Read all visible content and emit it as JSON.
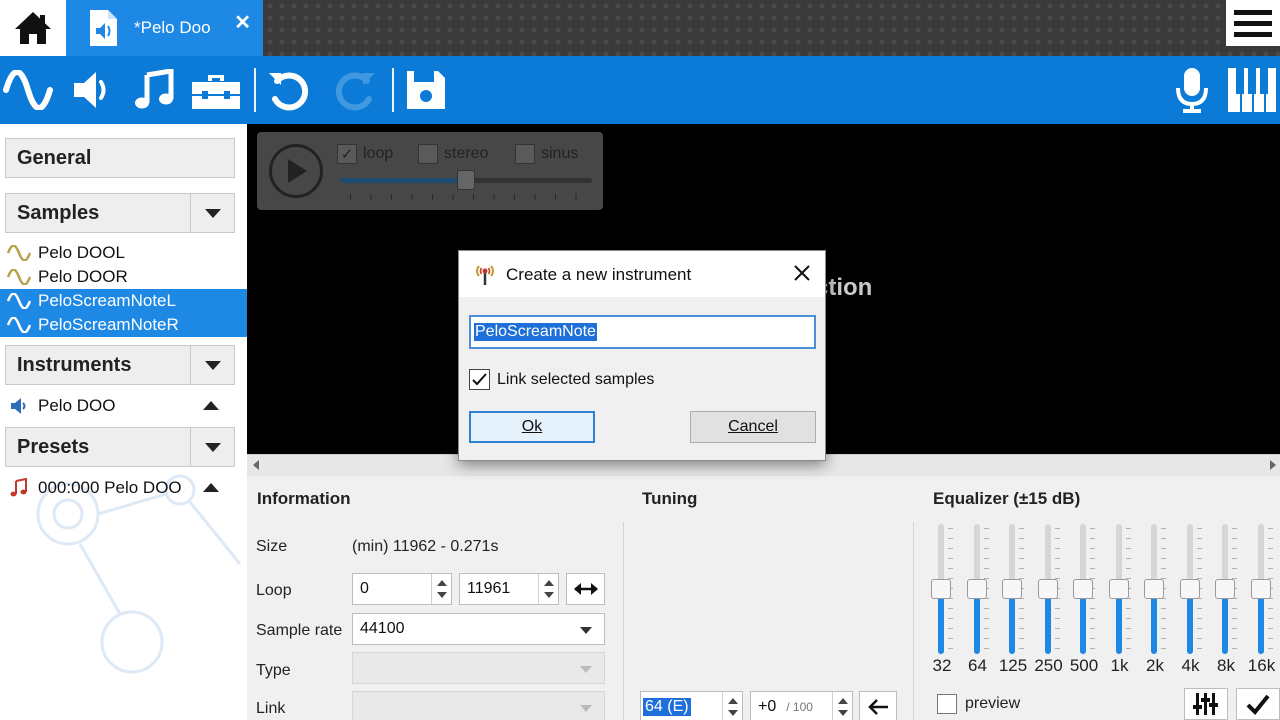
{
  "tabs": {
    "document_title": "*Pelo Doo",
    "close_glyph": "✕"
  },
  "toolbar": {
    "icons": [
      "sine-wave",
      "speaker",
      "music-note",
      "toolbox",
      "undo",
      "redo",
      "save",
      "microphone",
      "piano-keyboard"
    ],
    "accent": "#0c7bd8"
  },
  "sidebar": {
    "general_label": "General",
    "samples_label": "Samples",
    "samples": [
      {
        "name": "Pelo DOOL",
        "selected": false
      },
      {
        "name": "Pelo DOOR",
        "selected": false
      },
      {
        "name": "PeloScreamNoteL",
        "selected": true
      },
      {
        "name": "PeloScreamNoteR",
        "selected": true
      }
    ],
    "instruments_label": "Instruments",
    "instruments": [
      {
        "name": "Pelo DOO"
      }
    ],
    "presets_label": "Presets",
    "presets": [
      {
        "name": "000:000 Pelo DOO"
      }
    ]
  },
  "player": {
    "loop_label": "loop",
    "loop_checked": true,
    "stereo_label": "stereo",
    "stereo_checked": false,
    "sinus_label": "sinus",
    "sinus_checked": false,
    "volume_fraction": 0.5
  },
  "canvas": {
    "hint_fragment": "ction"
  },
  "information": {
    "title": "Information",
    "size_label": "Size",
    "size_value": "(min) 11962 - 0.271s",
    "loop_label": "Loop",
    "loop_start": "0",
    "loop_end": "11961",
    "sample_rate_label": "Sample rate",
    "sample_rate_value": "44100",
    "type_label": "Type",
    "link_label": "Link"
  },
  "tuning": {
    "title": "Tuning",
    "root_key": "64 (E)",
    "correction": "+0",
    "correction_suffix": "/ 100"
  },
  "equalizer": {
    "title": "Equalizer (±15 dB)",
    "bands": [
      "32",
      "64",
      "125",
      "250",
      "500",
      "1k",
      "2k",
      "4k",
      "8k",
      "16k"
    ],
    "gains_db": [
      0,
      0,
      0,
      0,
      0,
      0,
      0,
      0,
      0,
      0
    ],
    "preview_label": "preview",
    "preview_checked": false
  },
  "dialog": {
    "title": "Create a new instrument",
    "name_value": "PeloScreamNote",
    "link_label": "Link selected samples",
    "link_checked": true,
    "ok_label": "Ok",
    "cancel_label": "Cancel"
  }
}
